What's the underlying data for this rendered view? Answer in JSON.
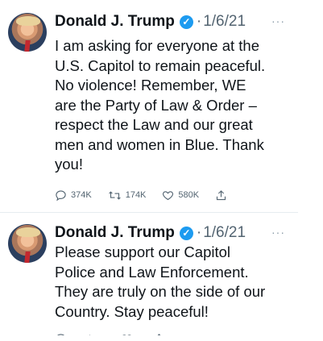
{
  "tweets": [
    {
      "name": "Donald J. Trump",
      "verified_icon": "verified-badge-icon",
      "separator": "·",
      "date": "1/6/21",
      "more": "···",
      "text": "I am asking for everyone at the\nU.S. Capitol to remain peaceful.\nNo violence! Remember, WE\nare the Party of Law & Order –\nrespect the Law and our great\nmen and women in Blue. Thank\nyou!",
      "replies": "374K",
      "retweets": "174K",
      "likes": "580K"
    },
    {
      "name": "Donald J. Trump",
      "verified_icon": "verified-badge-icon",
      "separator": "·",
      "date": "1/6/21",
      "more": "···",
      "text": "Please support our Capitol\nPolice and Law Enforcement.\nThey are truly on the side of our\nCountry. Stay peaceful!"
    }
  ],
  "colors": {
    "verified": "#1d9bf0",
    "text": "#0f1419",
    "muted": "#536471"
  }
}
